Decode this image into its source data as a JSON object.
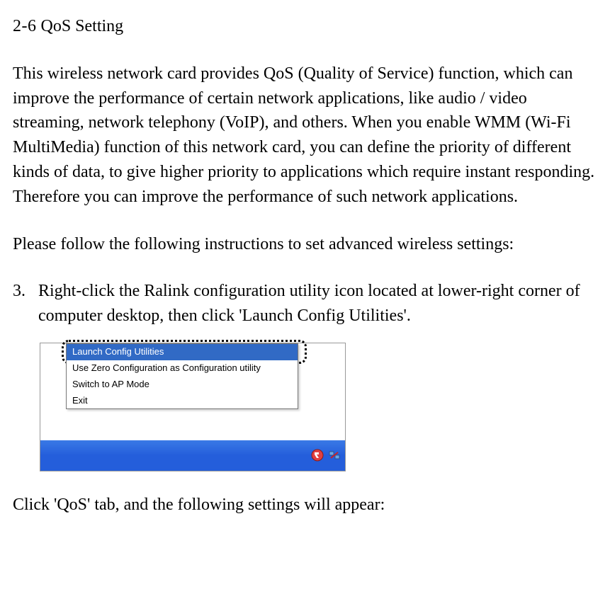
{
  "heading": {
    "number": "2-6",
    "title": "QoS Setting"
  },
  "paragraph1": "This wireless network card provides QoS (Quality of Service) function, which can improve the performance of certain network applications, like audio / video streaming, network telephony (VoIP), and others. When you enable WMM (Wi-Fi MultiMedia) function of this network card, you can define the priority of different kinds of data, to give higher priority to applications which require instant responding. Therefore you can improve the performance of such network applications.",
  "paragraph2": "Please follow the following instructions to set advanced wireless settings:",
  "list": {
    "number": "3.",
    "text": "Right-click the Ralink configuration utility icon located at lower-right corner of computer desktop, then click 'Launch Config Utilities'."
  },
  "menu": {
    "items": [
      "Launch Config Utilities",
      "Use Zero Configuration as Configuration utility",
      "Switch to AP Mode",
      "Exit"
    ]
  },
  "paragraph3": "Click 'QoS' tab, and the following settings will appear:"
}
